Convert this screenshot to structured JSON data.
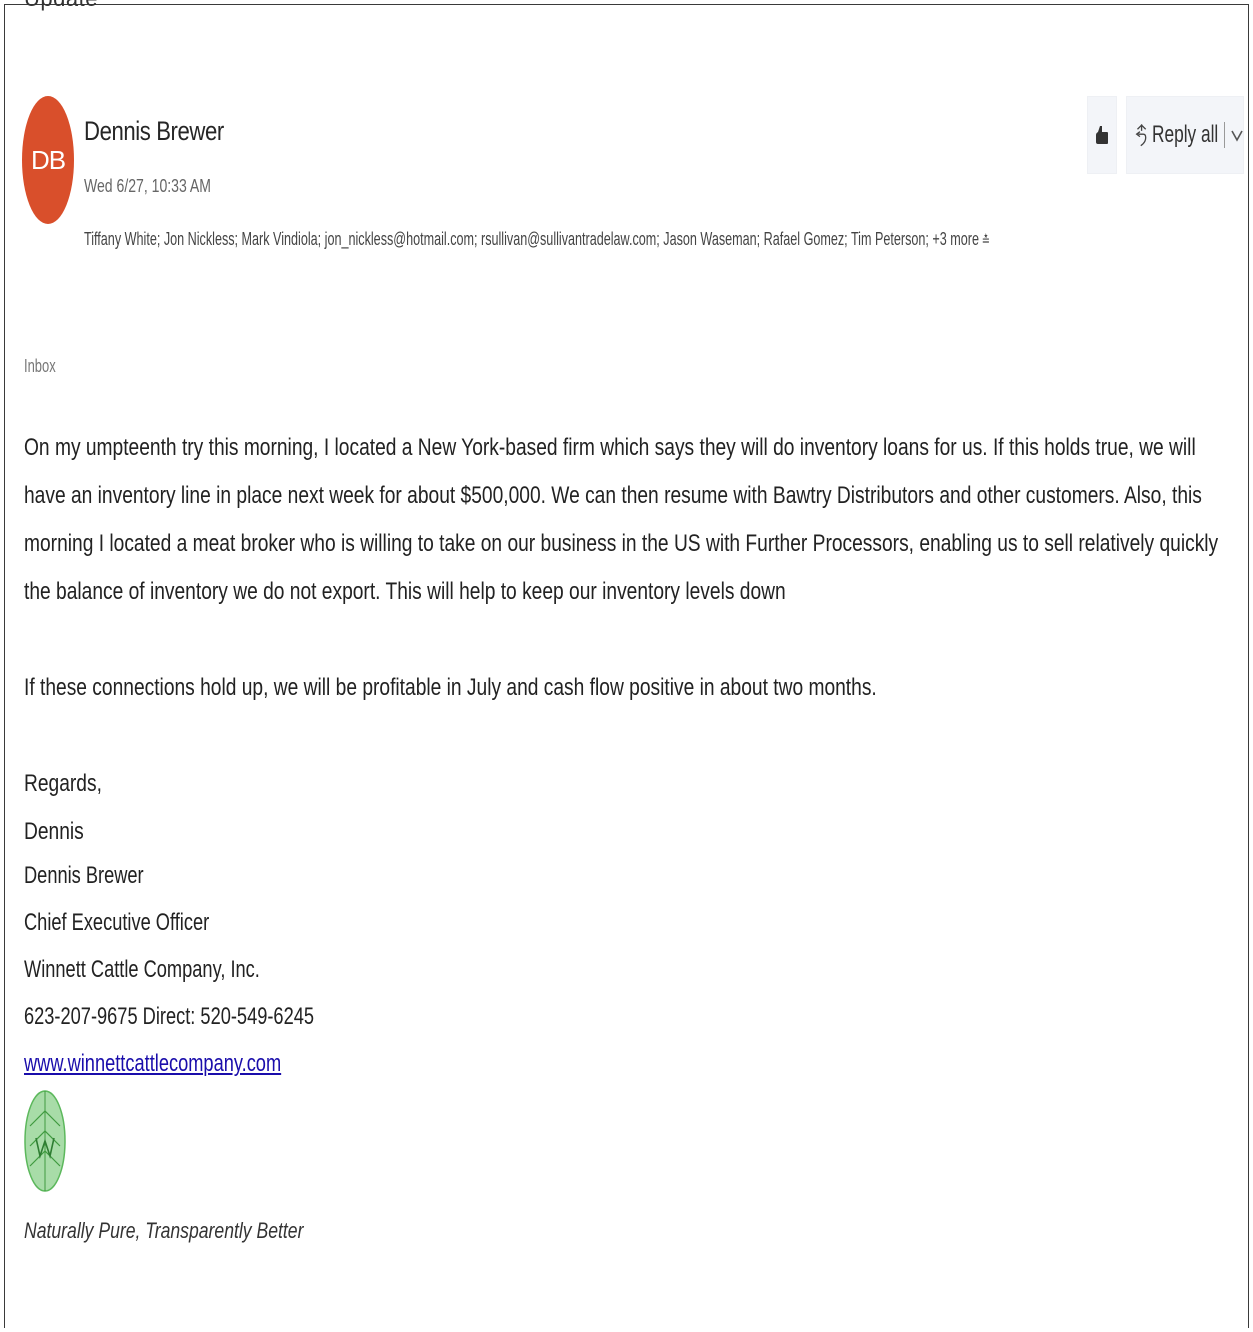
{
  "email": {
    "subject": "Update",
    "avatar_initials": "DB",
    "sender_name": "Dennis Brewer",
    "date": "Wed 6/27, 10:33 AM",
    "recipients": "Tiffany White; Jon Nickless; Mark Vindiola; jon_nickless@hotmail.com; rsullivan@sullivantradelaw.com; Jason Waseman; Rafael Gomez; Tim Peterson;",
    "more_label": "+3 more",
    "folder": "Inbox",
    "body": {
      "paragraph1": "On my umpteenth try this morning, I located a New York-based firm which says they will do inventory loans for us. If this holds true, we will have an inventory line in place next week for about $500,000. We can then resume with Bawtry Distributors and other customers. Also, this morning I located a meat broker who is willing to take on our business in the US with Further Processors, enabling us to sell relatively quickly the balance of inventory we do not export. This will help to keep our inventory levels down",
      "paragraph2": "If these connections hold up, we will be profitable in July and cash flow positive in about two months.",
      "closing": "Regards,",
      "signoff": "Dennis"
    },
    "signature": {
      "name": "Dennis Brewer",
      "title": "Chief Executive Officer",
      "company": "Winnett Cattle Company, Inc.",
      "phone": "623-207-9675 Direct: 520-549-6245",
      "website": "www.winnettcattlecompany.com",
      "logo_letters": "WC",
      "tagline": "Naturally Pure, Transparently Better"
    }
  },
  "actions": {
    "reply_all_label": "Reply all",
    "like_icon": "thumbs-up-icon",
    "reply_all_icon": "reply-all-icon",
    "dropdown_icon": "chevron-down-icon"
  },
  "colors": {
    "avatar_bg": "#d94f2b",
    "link": "#1a0dab",
    "logo_green": "#5cb85c"
  }
}
